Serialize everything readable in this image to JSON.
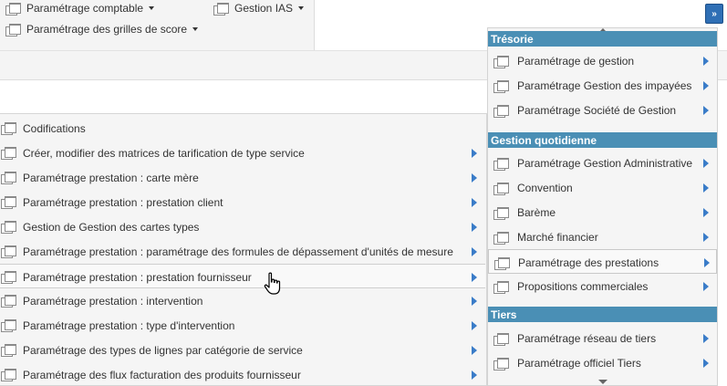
{
  "toolbar": {
    "items": [
      {
        "label": "Paramétrage comptable"
      },
      {
        "label": "Gestion IAS"
      },
      {
        "label": "Paramétrage des grilles de score"
      }
    ],
    "overflow_label": "»"
  },
  "submenu": {
    "items": [
      {
        "label": "Codifications",
        "has_submenu": false
      },
      {
        "label": "Créer, modifier des matrices de tarification de type service",
        "has_submenu": true
      },
      {
        "label": "Paramétrage prestation : carte mère",
        "has_submenu": true
      },
      {
        "label": "Paramétrage prestation : prestation client",
        "has_submenu": true
      },
      {
        "label": "Gestion de Gestion des cartes types",
        "has_submenu": true
      },
      {
        "label": "Paramétrage prestation : paramétrage des formules de dépassement d'unités de mesure",
        "has_submenu": true
      },
      {
        "label": "Paramétrage prestation : prestation fournisseur",
        "has_submenu": true,
        "hovered": true
      },
      {
        "label": "Paramétrage prestation : intervention",
        "has_submenu": true
      },
      {
        "label": "Paramétrage prestation : type d'intervention",
        "has_submenu": true
      },
      {
        "label": "Paramétrage des types de lignes par catégorie de service",
        "has_submenu": true
      },
      {
        "label": "Paramétrage des flux facturation des produits fournisseur",
        "has_submenu": true
      }
    ]
  },
  "panel": {
    "sections": [
      {
        "title": "Trésorie",
        "items": [
          {
            "label": "Paramétrage de gestion"
          },
          {
            "label": "Paramétrage Gestion des impayées"
          },
          {
            "label": "Paramétrage Société de Gestion"
          }
        ]
      },
      {
        "title": "Gestion quotidienne",
        "items": [
          {
            "label": "Paramétrage Gestion Administrative"
          },
          {
            "label": "Convention"
          },
          {
            "label": "Barème"
          },
          {
            "label": "Marché financier"
          },
          {
            "label": "Paramétrage des prestations",
            "active": true
          },
          {
            "label": "Propositions commerciales"
          }
        ]
      },
      {
        "title": "Tiers",
        "items": [
          {
            "label": "Paramétrage réseau de tiers"
          },
          {
            "label": "Paramétrage officiel Tiers"
          }
        ]
      }
    ]
  },
  "colors": {
    "section_header": "#4a8fb5",
    "arrow": "#3a7cc8",
    "overflow_button": "#2f6fb5"
  },
  "icons": {
    "menu_item": "window-icon",
    "submenu_indicator": "arrow-right-icon",
    "pointer": "hand-cursor-icon"
  }
}
